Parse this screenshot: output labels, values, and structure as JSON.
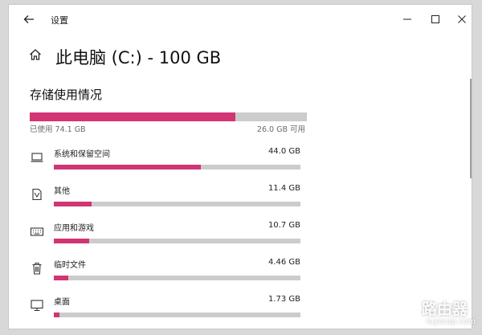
{
  "window": {
    "title": "设置",
    "controls": {
      "minimize": "minimize-icon",
      "maximize": "maximize-icon",
      "close": "close-icon"
    }
  },
  "header": {
    "home_icon": "home-icon",
    "title": "此电脑 (C:) - 100 GB"
  },
  "storage": {
    "section_title": "存储使用情况",
    "used_label": "已使用 74.1 GB",
    "free_label": "26.0 GB 可用",
    "used_fraction": 0.741
  },
  "categories": [
    {
      "name": "系统和保留空间",
      "size": "44.0 GB",
      "icon": "laptop-icon",
      "fraction": 0.595
    },
    {
      "name": "其他",
      "size": "11.4 GB",
      "icon": "document-icon",
      "fraction": 0.154
    },
    {
      "name": "应用和游戏",
      "size": "10.7 GB",
      "icon": "keyboard-icon",
      "fraction": 0.144
    },
    {
      "name": "临时文件",
      "size": "4.46 GB",
      "icon": "trash-icon",
      "fraction": 0.06
    },
    {
      "name": "桌面",
      "size": "1.73 GB",
      "icon": "monitor-icon",
      "fraction": 0.023
    }
  ],
  "colors": {
    "accent": "#d13574",
    "track": "#cccccc"
  },
  "watermark": {
    "text": "路由器",
    "url": "luyouqi.com"
  }
}
